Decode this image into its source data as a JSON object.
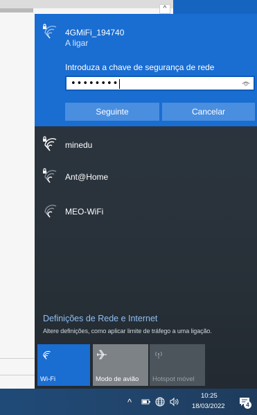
{
  "active_network": {
    "name": "4GMiFi_194740",
    "status": "A ligar",
    "password_prompt": "Introduza a chave de segurança de rede",
    "password_value": "••••••••",
    "next_label": "Seguinte",
    "cancel_label": "Cancelar"
  },
  "networks": [
    {
      "name": "minedu",
      "secured": true
    },
    {
      "name": "Ant@Home",
      "secured": true
    },
    {
      "name": "MEO-WiFi",
      "secured": false
    }
  ],
  "settings": {
    "link": "Definições de Rede e Internet",
    "subtitle": "Altere definições, como aplicar limite de tráfego a uma ligação."
  },
  "quick_actions": [
    {
      "label": "Wi-Fi",
      "icon": "wifi-icon",
      "state": "on"
    },
    {
      "label": "Modo de avião",
      "icon": "airplane-icon",
      "state": "off"
    },
    {
      "label": "Hotspot móvel",
      "icon": "hotspot-icon",
      "state": "disabled"
    }
  ],
  "taskbar": {
    "time": "10:25",
    "date": "18/03/2022",
    "notification_count": "4"
  },
  "colors": {
    "accent": "#1a6dd1",
    "flyout_bg": "#2a333c",
    "link": "#8fbff3"
  }
}
